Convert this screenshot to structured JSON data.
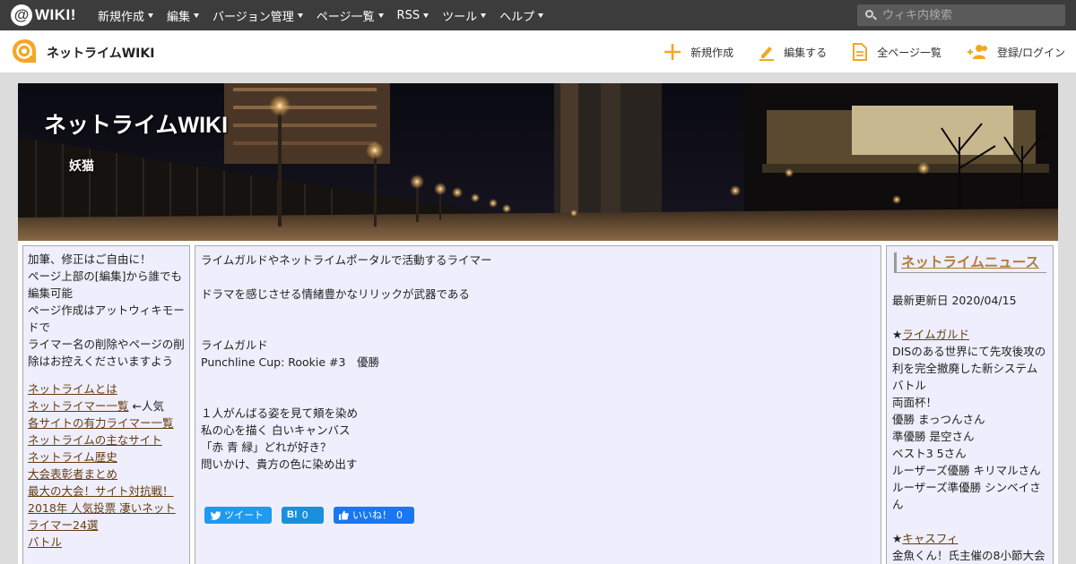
{
  "topbar": {
    "logo_mark": "@",
    "logo_text": "WIKI!",
    "menu": [
      {
        "label": "新規作成"
      },
      {
        "label": "編集"
      },
      {
        "label": "バージョン管理"
      },
      {
        "label": "ページ一覧"
      },
      {
        "label": "RSS"
      },
      {
        "label": "ツール"
      },
      {
        "label": "ヘルプ"
      }
    ],
    "search_placeholder": "ウィキ内検索"
  },
  "wikibar": {
    "name": "ネットライムWIKI",
    "actions": [
      {
        "label": "新規作成",
        "icon": "plus-icon"
      },
      {
        "label": "編集する",
        "icon": "pencil-icon"
      },
      {
        "label": "全ページ一覧",
        "icon": "page-icon"
      },
      {
        "label": "登録/ログイン",
        "icon": "users-icon"
      }
    ],
    "accent_color": "#f5a623"
  },
  "banner": {
    "title": "ネットライムWIKI",
    "subtitle": "妖猫"
  },
  "left": {
    "intro": [
      "加筆、修正はご自由に！",
      "ページ上部の[編集]から誰でも編集可能",
      "ページ作成はアットウィキモードで",
      "ライマー名の削除やページの削除はお控えくださいますよう"
    ],
    "links": [
      {
        "text": "ネットライムとは",
        "note": ""
      },
      {
        "text": "ネットライマー一覧",
        "note": " ←人気"
      },
      {
        "text": "各サイトの有力ライマー一覧",
        "note": ""
      },
      {
        "text": "ネットライムの主なサイト",
        "note": ""
      },
      {
        "text": "ネットライム歴史",
        "note": ""
      },
      {
        "text": "大会表彰者まとめ",
        "note": ""
      },
      {
        "text": "最大の大会！サイト対抗戦！",
        "note": ""
      },
      {
        "text": "2018年 人気投票 凄いネットライマー24選",
        "note": ""
      },
      {
        "text": "バトル",
        "note": ""
      }
    ]
  },
  "main": {
    "intro1": "ライムガルドやネットライムポータルで活動するライマー",
    "intro2": "ドラマを感じさせる情緒豊かなリリックが武器である",
    "site": "ライムガルド",
    "record": "Punchline Cup: Rookie #3　優勝",
    "lyric": [
      "１人がんばる姿を見て頬を染め",
      "私の心を描く 白いキャンバス",
      "「赤 青 緑」どれが好き？",
      "問いかけ、貴方の色に染め出す"
    ],
    "share": {
      "tweet": "ツイート",
      "hatena_mark": "B!",
      "hatena_count": "0",
      "like": "いいね！",
      "like_count": "0"
    }
  },
  "right": {
    "news_title": "ネットライムニュース",
    "updated": "最新更新日 2020/04/15",
    "item1_link": "ライムガルド",
    "item1_lines": [
      "DISのある世界にて先攻後攻の利を完全撤廃した新システムバトル",
      "両面杯！",
      "優勝 まっつんさん",
      "準優勝 是空さん",
      "ベスト3 5さん",
      "ルーザーズ優勝 キリマルさん",
      "ルーザーズ準優勝 シンベイさん"
    ],
    "item2_link": "キャスフィ",
    "item2_lines": [
      "金魚くん！氏主催の8小節大会"
    ]
  }
}
